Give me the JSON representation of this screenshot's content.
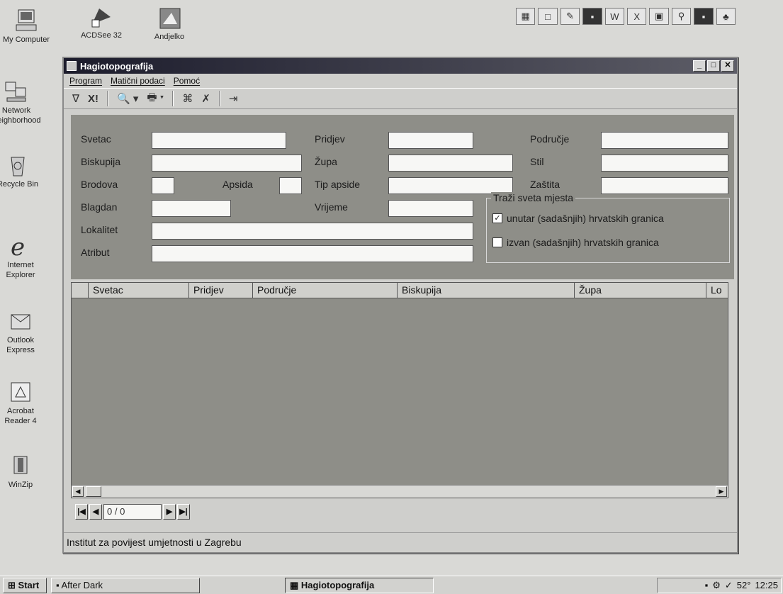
{
  "desktop": {
    "icons": [
      {
        "label": "My Computer",
        "icon": "my-computer-icon"
      },
      {
        "label": "ACDSee 32",
        "icon": "acdsee-icon"
      },
      {
        "label": "Andjelko",
        "icon": "andjelko-shortcut-icon"
      },
      {
        "label": "Network\nNeighborhood",
        "icon": "network-neighborhood-icon"
      },
      {
        "label": "Recycle Bin",
        "icon": "recycle-bin-icon"
      },
      {
        "label": "Internet\nExplorer",
        "icon": "internet-explorer-icon"
      },
      {
        "label": "Outlook\nExpress",
        "icon": "outlook-express-icon"
      },
      {
        "label": "Acrobat\nReader 4",
        "icon": "acrobat-reader-icon"
      },
      {
        "label": "WinZip",
        "icon": "winzip-icon"
      }
    ]
  },
  "window": {
    "title": "Hagiotopografija",
    "menu": [
      "Program",
      "Matični podaci",
      "Pomoć"
    ],
    "toolbar": [
      "∇",
      "X!",
      "🔍",
      "🖶",
      "⌘",
      "✗",
      "⇥"
    ]
  },
  "form": {
    "svetac": "Svetac",
    "pridjev": "Pridjev",
    "podrucje": "Područje",
    "biskupija": "Biskupija",
    "zupa": "Župa",
    "stil": "Stil",
    "brodova": "Brodova",
    "apsida": "Apsida",
    "tip_apside": "Tip apside",
    "zastita": "Zaštita",
    "blagdan": "Blagdan",
    "vrijeme": "Vrijeme",
    "lokalitet": "Lokalitet",
    "atribut": "Atribut",
    "group_title": "Traži sveta mjesta",
    "opt_unutar": "unutar (sadašnjih) hrvatskih granica",
    "opt_izvan": "izvan (sadašnjih) hrvatskih granica",
    "opt_unutar_checked": true,
    "opt_izvan_checked": false
  },
  "grid": {
    "columns": [
      "",
      "Svetac",
      "Pridjev",
      "Područje",
      "Biskupija",
      "Župa",
      "Lo"
    ]
  },
  "navigator": {
    "position": "0 / 0"
  },
  "status": "Institut za povijest umjetnosti u Zagrebu",
  "taskbar": {
    "start": "Start",
    "task1": "After Dark",
    "task2": "Hagiotopografija",
    "clock": "12:25",
    "tray_temp": "52°"
  }
}
